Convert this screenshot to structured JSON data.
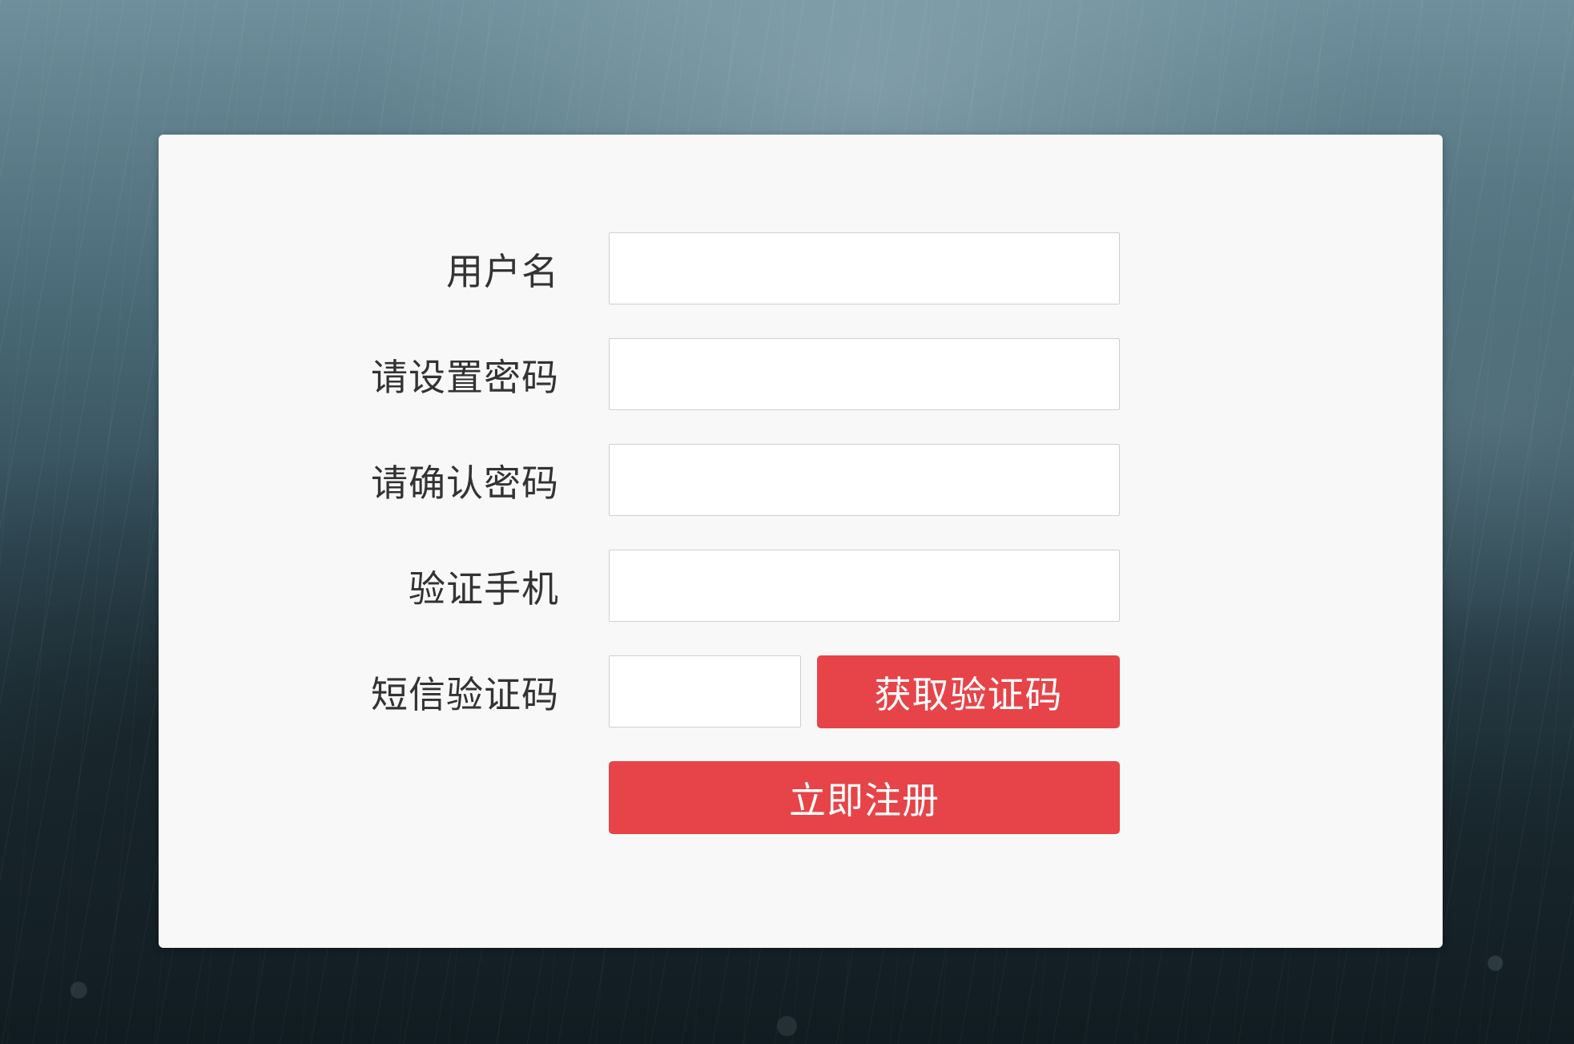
{
  "form": {
    "fields": [
      {
        "label": "用户名",
        "value": ""
      },
      {
        "label": "请设置密码",
        "value": ""
      },
      {
        "label": "请确认密码",
        "value": ""
      },
      {
        "label": "验证手机",
        "value": ""
      },
      {
        "label": "短信验证码",
        "value": ""
      }
    ],
    "get_code_label": "获取验证码",
    "register_label": "立即注册"
  },
  "colors": {
    "button": "#e64448",
    "card": "#f8f8f8",
    "label": "#333333"
  }
}
